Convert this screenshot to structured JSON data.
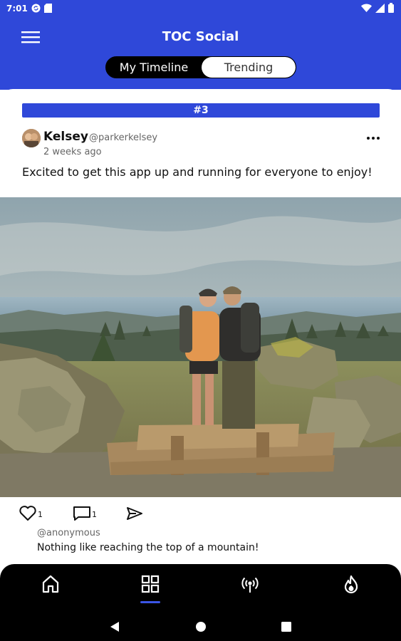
{
  "status_bar": {
    "time": "7:01",
    "icons": [
      "sync-icon",
      "sd-card-icon",
      "wifi-icon",
      "signal-icon",
      "battery-icon"
    ]
  },
  "app_bar": {
    "title": "TOC Social",
    "menu_icon": "hamburger-icon",
    "background": "#2f48d9"
  },
  "tabs": [
    {
      "label": "My Timeline",
      "active": true
    },
    {
      "label": "Trending",
      "active": false
    }
  ],
  "post": {
    "rank": "#3",
    "author": "Kelsey",
    "handle": "@parkerkelsey",
    "time_ago": "2 weeks ago",
    "text": "Excited to get this app up and running for everyone to enjoy!",
    "image_icon": "mountain-photo",
    "likes": "1",
    "comments": "1"
  },
  "comment": {
    "handle": "@anonymous",
    "text": "Nothing like reaching the top of a mountain!"
  },
  "bottom_nav": {
    "items": [
      "home-icon",
      "dashboard-icon",
      "broadcast-icon",
      "flame-icon"
    ],
    "active_index": 1,
    "indicator_color": "#3b55e6"
  },
  "system_nav": [
    "back-icon",
    "home-circle-icon",
    "recents-icon"
  ]
}
